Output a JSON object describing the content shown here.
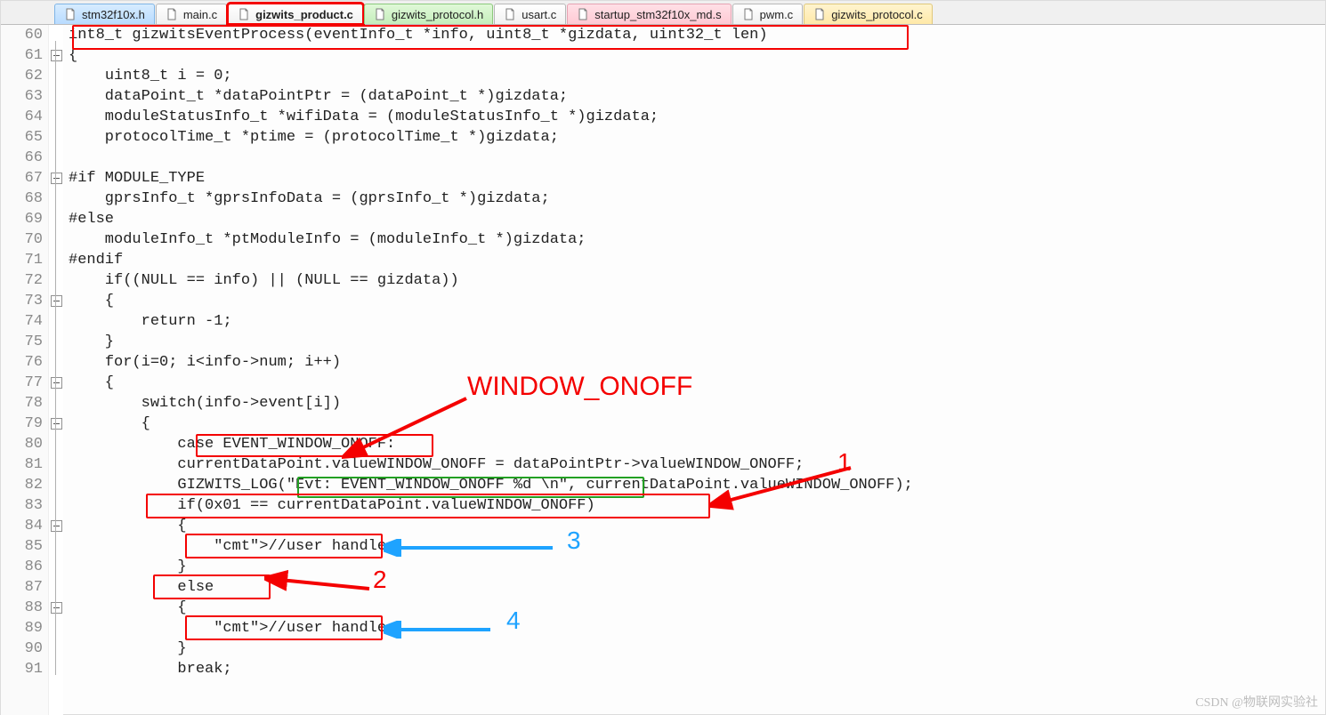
{
  "tabs": [
    {
      "label": "stm32f10x.h",
      "cls": "blue"
    },
    {
      "label": "main.c",
      "cls": "plain"
    },
    {
      "label": "gizwits_product.c",
      "cls": "plain",
      "active": true
    },
    {
      "label": "gizwits_protocol.h",
      "cls": "green"
    },
    {
      "label": "usart.c",
      "cls": "plain"
    },
    {
      "label": "startup_stm32f10x_md.s",
      "cls": "pink"
    },
    {
      "label": "pwm.c",
      "cls": "plain"
    },
    {
      "label": "gizwits_protocol.c",
      "cls": "yellow"
    }
  ],
  "firstLine": 60,
  "lastLine": 91,
  "code": {
    "l60": "int8_t gizwitsEventProcess(eventInfo_t *info, uint8_t *gizdata, uint32_t len)",
    "l61": "{",
    "l62": "    uint8_t i = 0;",
    "l63": "    dataPoint_t *dataPointPtr = (dataPoint_t *)gizdata;",
    "l64": "    moduleStatusInfo_t *wifiData = (moduleStatusInfo_t *)gizdata;",
    "l65": "    protocolTime_t *ptime = (protocolTime_t *)gizdata;",
    "l66": "",
    "l67": "#if MODULE_TYPE",
    "l68": "    gprsInfo_t *gprsInfoData = (gprsInfo_t *)gizdata;",
    "l69": "#else",
    "l70": "    moduleInfo_t *ptModuleInfo = (moduleInfo_t *)gizdata;",
    "l71": "#endif",
    "l72": "    if((NULL == info) || (NULL == gizdata))",
    "l73": "    {",
    "l74": "        return -1;",
    "l75": "    }",
    "l76": "    for(i=0; i<info->num; i++)",
    "l77": "    {",
    "l78": "        switch(info->event[i])",
    "l79": "        {",
    "l80": "            case EVENT_WINDOW_ONOFF:",
    "l81": "            currentDataPoint.valueWINDOW_ONOFF = dataPointPtr->valueWINDOW_ONOFF;",
    "l82": "            GIZWITS_LOG(\"Evt: EVENT_WINDOW_ONOFF %d \\n\", currentDataPoint.valueWINDOW_ONOFF);",
    "l83": "            if(0x01 == currentDataPoint.valueWINDOW_ONOFF)",
    "l84": "            {",
    "l85": "                //user handle",
    "l86": "            }",
    "l87": "            else",
    "l88": "            {",
    "l89": "                //user handle",
    "l90": "            }",
    "l91": "            break;"
  },
  "annotations": {
    "window": "WINDOW_ONOFF",
    "one": "1",
    "two": "2",
    "three": "3",
    "four": "4"
  },
  "watermark": "CSDN @物联网实验社"
}
